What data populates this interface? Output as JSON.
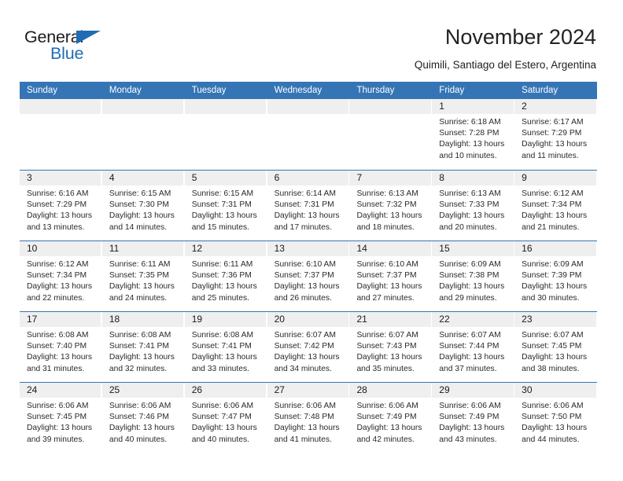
{
  "brand": {
    "name_top": "General",
    "name_bottom": "Blue",
    "accent_color": "#1f6cb4"
  },
  "header": {
    "title": "November 2024",
    "subtitle": "Quimili, Santiago del Estero, Argentina"
  },
  "theme": {
    "header_blue": "#3575b5",
    "daynum_band": "#efefef",
    "text": "#222222"
  },
  "calendar": {
    "weekday_headers": [
      "Sunday",
      "Monday",
      "Tuesday",
      "Wednesday",
      "Thursday",
      "Friday",
      "Saturday"
    ],
    "weeks": [
      [
        {
          "day": "",
          "sunrise": "",
          "sunset": "",
          "daylight": ""
        },
        {
          "day": "",
          "sunrise": "",
          "sunset": "",
          "daylight": ""
        },
        {
          "day": "",
          "sunrise": "",
          "sunset": "",
          "daylight": ""
        },
        {
          "day": "",
          "sunrise": "",
          "sunset": "",
          "daylight": ""
        },
        {
          "day": "",
          "sunrise": "",
          "sunset": "",
          "daylight": ""
        },
        {
          "day": "1",
          "sunrise": "Sunrise: 6:18 AM",
          "sunset": "Sunset: 7:28 PM",
          "daylight": "Daylight: 13 hours and 10 minutes."
        },
        {
          "day": "2",
          "sunrise": "Sunrise: 6:17 AM",
          "sunset": "Sunset: 7:29 PM",
          "daylight": "Daylight: 13 hours and 11 minutes."
        }
      ],
      [
        {
          "day": "3",
          "sunrise": "Sunrise: 6:16 AM",
          "sunset": "Sunset: 7:29 PM",
          "daylight": "Daylight: 13 hours and 13 minutes."
        },
        {
          "day": "4",
          "sunrise": "Sunrise: 6:15 AM",
          "sunset": "Sunset: 7:30 PM",
          "daylight": "Daylight: 13 hours and 14 minutes."
        },
        {
          "day": "5",
          "sunrise": "Sunrise: 6:15 AM",
          "sunset": "Sunset: 7:31 PM",
          "daylight": "Daylight: 13 hours and 15 minutes."
        },
        {
          "day": "6",
          "sunrise": "Sunrise: 6:14 AM",
          "sunset": "Sunset: 7:31 PM",
          "daylight": "Daylight: 13 hours and 17 minutes."
        },
        {
          "day": "7",
          "sunrise": "Sunrise: 6:13 AM",
          "sunset": "Sunset: 7:32 PM",
          "daylight": "Daylight: 13 hours and 18 minutes."
        },
        {
          "day": "8",
          "sunrise": "Sunrise: 6:13 AM",
          "sunset": "Sunset: 7:33 PM",
          "daylight": "Daylight: 13 hours and 20 minutes."
        },
        {
          "day": "9",
          "sunrise": "Sunrise: 6:12 AM",
          "sunset": "Sunset: 7:34 PM",
          "daylight": "Daylight: 13 hours and 21 minutes."
        }
      ],
      [
        {
          "day": "10",
          "sunrise": "Sunrise: 6:12 AM",
          "sunset": "Sunset: 7:34 PM",
          "daylight": "Daylight: 13 hours and 22 minutes."
        },
        {
          "day": "11",
          "sunrise": "Sunrise: 6:11 AM",
          "sunset": "Sunset: 7:35 PM",
          "daylight": "Daylight: 13 hours and 24 minutes."
        },
        {
          "day": "12",
          "sunrise": "Sunrise: 6:11 AM",
          "sunset": "Sunset: 7:36 PM",
          "daylight": "Daylight: 13 hours and 25 minutes."
        },
        {
          "day": "13",
          "sunrise": "Sunrise: 6:10 AM",
          "sunset": "Sunset: 7:37 PM",
          "daylight": "Daylight: 13 hours and 26 minutes."
        },
        {
          "day": "14",
          "sunrise": "Sunrise: 6:10 AM",
          "sunset": "Sunset: 7:37 PM",
          "daylight": "Daylight: 13 hours and 27 minutes."
        },
        {
          "day": "15",
          "sunrise": "Sunrise: 6:09 AM",
          "sunset": "Sunset: 7:38 PM",
          "daylight": "Daylight: 13 hours and 29 minutes."
        },
        {
          "day": "16",
          "sunrise": "Sunrise: 6:09 AM",
          "sunset": "Sunset: 7:39 PM",
          "daylight": "Daylight: 13 hours and 30 minutes."
        }
      ],
      [
        {
          "day": "17",
          "sunrise": "Sunrise: 6:08 AM",
          "sunset": "Sunset: 7:40 PM",
          "daylight": "Daylight: 13 hours and 31 minutes."
        },
        {
          "day": "18",
          "sunrise": "Sunrise: 6:08 AM",
          "sunset": "Sunset: 7:41 PM",
          "daylight": "Daylight: 13 hours and 32 minutes."
        },
        {
          "day": "19",
          "sunrise": "Sunrise: 6:08 AM",
          "sunset": "Sunset: 7:41 PM",
          "daylight": "Daylight: 13 hours and 33 minutes."
        },
        {
          "day": "20",
          "sunrise": "Sunrise: 6:07 AM",
          "sunset": "Sunset: 7:42 PM",
          "daylight": "Daylight: 13 hours and 34 minutes."
        },
        {
          "day": "21",
          "sunrise": "Sunrise: 6:07 AM",
          "sunset": "Sunset: 7:43 PM",
          "daylight": "Daylight: 13 hours and 35 minutes."
        },
        {
          "day": "22",
          "sunrise": "Sunrise: 6:07 AM",
          "sunset": "Sunset: 7:44 PM",
          "daylight": "Daylight: 13 hours and 37 minutes."
        },
        {
          "day": "23",
          "sunrise": "Sunrise: 6:07 AM",
          "sunset": "Sunset: 7:45 PM",
          "daylight": "Daylight: 13 hours and 38 minutes."
        }
      ],
      [
        {
          "day": "24",
          "sunrise": "Sunrise: 6:06 AM",
          "sunset": "Sunset: 7:45 PM",
          "daylight": "Daylight: 13 hours and 39 minutes."
        },
        {
          "day": "25",
          "sunrise": "Sunrise: 6:06 AM",
          "sunset": "Sunset: 7:46 PM",
          "daylight": "Daylight: 13 hours and 40 minutes."
        },
        {
          "day": "26",
          "sunrise": "Sunrise: 6:06 AM",
          "sunset": "Sunset: 7:47 PM",
          "daylight": "Daylight: 13 hours and 40 minutes."
        },
        {
          "day": "27",
          "sunrise": "Sunrise: 6:06 AM",
          "sunset": "Sunset: 7:48 PM",
          "daylight": "Daylight: 13 hours and 41 minutes."
        },
        {
          "day": "28",
          "sunrise": "Sunrise: 6:06 AM",
          "sunset": "Sunset: 7:49 PM",
          "daylight": "Daylight: 13 hours and 42 minutes."
        },
        {
          "day": "29",
          "sunrise": "Sunrise: 6:06 AM",
          "sunset": "Sunset: 7:49 PM",
          "daylight": "Daylight: 13 hours and 43 minutes."
        },
        {
          "day": "30",
          "sunrise": "Sunrise: 6:06 AM",
          "sunset": "Sunset: 7:50 PM",
          "daylight": "Daylight: 13 hours and 44 minutes."
        }
      ]
    ]
  }
}
